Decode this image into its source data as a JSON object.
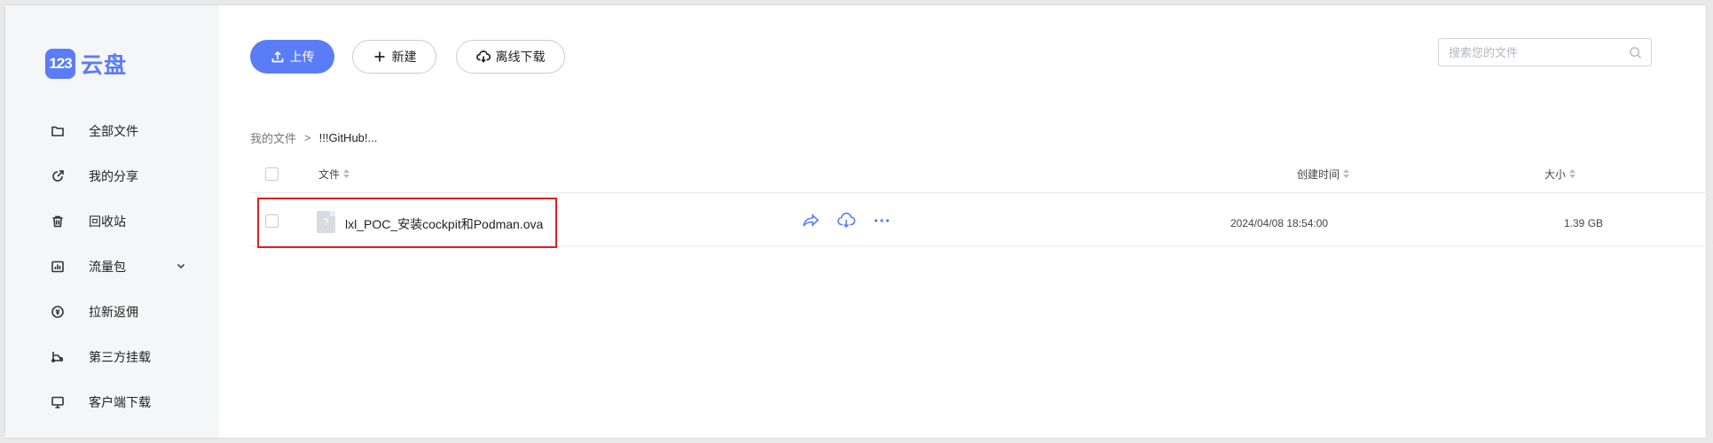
{
  "logo": {
    "badge": "123",
    "text": "云盘"
  },
  "sidebar": {
    "items": [
      {
        "label": "全部文件",
        "icon": "folder-icon"
      },
      {
        "label": "我的分享",
        "icon": "share-icon"
      },
      {
        "label": "回收站",
        "icon": "trash-icon"
      },
      {
        "label": "流量包",
        "icon": "chart-icon",
        "expandable": true
      },
      {
        "label": "拉新返佣",
        "icon": "coin-icon"
      },
      {
        "label": "第三方挂载",
        "icon": "mount-icon"
      },
      {
        "label": "客户端下载",
        "icon": "monitor-icon"
      }
    ]
  },
  "toolbar": {
    "upload_label": "上传",
    "new_label": "新建",
    "offline_label": "离线下载"
  },
  "search": {
    "placeholder": "搜索您的文件"
  },
  "breadcrumb": {
    "root": "我的文件",
    "separator": ">",
    "current": "!!!GitHub!..."
  },
  "table": {
    "columns": {
      "file": "文件",
      "created": "创建时间",
      "size": "大小"
    },
    "rows": [
      {
        "name": "lxl_POC_安装cockpit和Podman.ova",
        "created": "2024/04/08 18:54:00",
        "size": "1.39 GB",
        "file_icon": "?"
      }
    ]
  },
  "colors": {
    "accent": "#5b7cf7",
    "highlight": "#e02020",
    "sidebar_bg": "#f5f6f8"
  }
}
